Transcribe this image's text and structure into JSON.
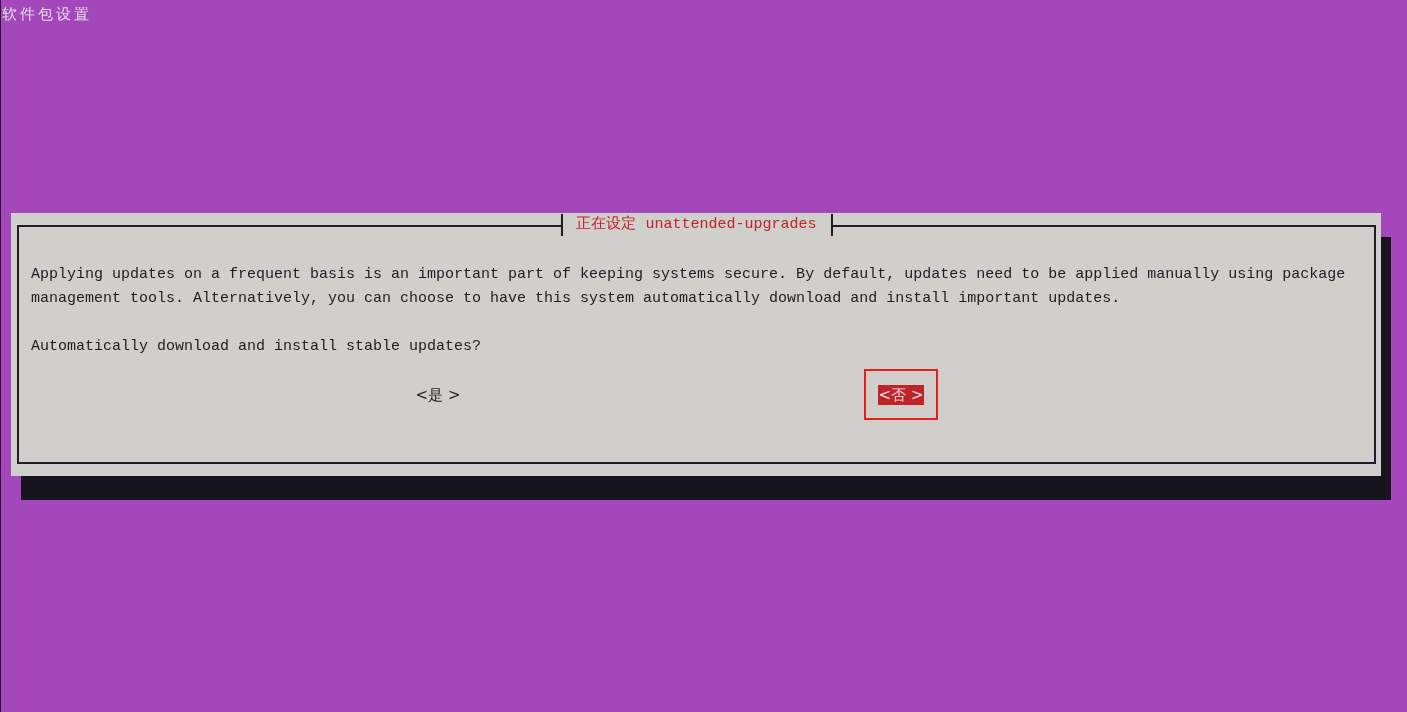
{
  "screen_title": "软件包设置",
  "dialog": {
    "title": "正在设定 unattended-upgrades",
    "message": "Applying updates on a frequent basis is an important part of keeping systems secure. By default, updates need to be applied manually using package management tools. Alternatively, you can choose to have this system automatically download and install important updates.",
    "question": "Automatically download and install stable updates?",
    "buttons": [
      {
        "label": "<是 >",
        "selected": false
      },
      {
        "label": "<否 >",
        "selected": true
      }
    ]
  }
}
